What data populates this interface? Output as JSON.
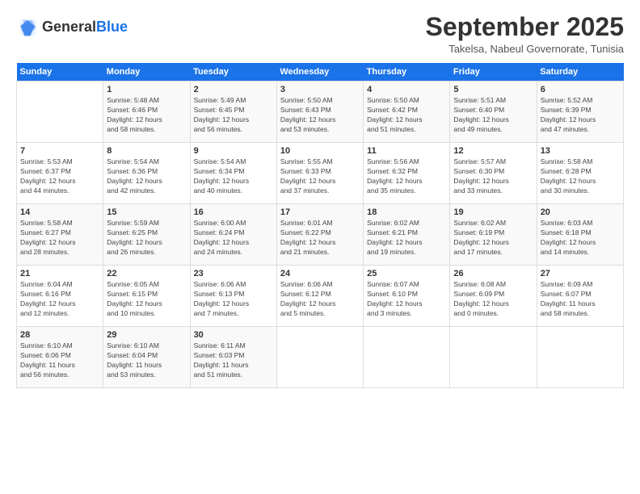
{
  "logo": {
    "line1": "General",
    "line2": "Blue"
  },
  "title": "September 2025",
  "subtitle": "Takelsa, Nabeul Governorate, Tunisia",
  "days_of_week": [
    "Sunday",
    "Monday",
    "Tuesday",
    "Wednesday",
    "Thursday",
    "Friday",
    "Saturday"
  ],
  "weeks": [
    [
      {
        "day": "",
        "info": ""
      },
      {
        "day": "1",
        "info": "Sunrise: 5:48 AM\nSunset: 6:46 PM\nDaylight: 12 hours\nand 58 minutes."
      },
      {
        "day": "2",
        "info": "Sunrise: 5:49 AM\nSunset: 6:45 PM\nDaylight: 12 hours\nand 56 minutes."
      },
      {
        "day": "3",
        "info": "Sunrise: 5:50 AM\nSunset: 6:43 PM\nDaylight: 12 hours\nand 53 minutes."
      },
      {
        "day": "4",
        "info": "Sunrise: 5:50 AM\nSunset: 6:42 PM\nDaylight: 12 hours\nand 51 minutes."
      },
      {
        "day": "5",
        "info": "Sunrise: 5:51 AM\nSunset: 6:40 PM\nDaylight: 12 hours\nand 49 minutes."
      },
      {
        "day": "6",
        "info": "Sunrise: 5:52 AM\nSunset: 6:39 PM\nDaylight: 12 hours\nand 47 minutes."
      }
    ],
    [
      {
        "day": "7",
        "info": "Sunrise: 5:53 AM\nSunset: 6:37 PM\nDaylight: 12 hours\nand 44 minutes."
      },
      {
        "day": "8",
        "info": "Sunrise: 5:54 AM\nSunset: 6:36 PM\nDaylight: 12 hours\nand 42 minutes."
      },
      {
        "day": "9",
        "info": "Sunrise: 5:54 AM\nSunset: 6:34 PM\nDaylight: 12 hours\nand 40 minutes."
      },
      {
        "day": "10",
        "info": "Sunrise: 5:55 AM\nSunset: 6:33 PM\nDaylight: 12 hours\nand 37 minutes."
      },
      {
        "day": "11",
        "info": "Sunrise: 5:56 AM\nSunset: 6:32 PM\nDaylight: 12 hours\nand 35 minutes."
      },
      {
        "day": "12",
        "info": "Sunrise: 5:57 AM\nSunset: 6:30 PM\nDaylight: 12 hours\nand 33 minutes."
      },
      {
        "day": "13",
        "info": "Sunrise: 5:58 AM\nSunset: 6:28 PM\nDaylight: 12 hours\nand 30 minutes."
      }
    ],
    [
      {
        "day": "14",
        "info": "Sunrise: 5:58 AM\nSunset: 6:27 PM\nDaylight: 12 hours\nand 28 minutes."
      },
      {
        "day": "15",
        "info": "Sunrise: 5:59 AM\nSunset: 6:25 PM\nDaylight: 12 hours\nand 26 minutes."
      },
      {
        "day": "16",
        "info": "Sunrise: 6:00 AM\nSunset: 6:24 PM\nDaylight: 12 hours\nand 24 minutes."
      },
      {
        "day": "17",
        "info": "Sunrise: 6:01 AM\nSunset: 6:22 PM\nDaylight: 12 hours\nand 21 minutes."
      },
      {
        "day": "18",
        "info": "Sunrise: 6:02 AM\nSunset: 6:21 PM\nDaylight: 12 hours\nand 19 minutes."
      },
      {
        "day": "19",
        "info": "Sunrise: 6:02 AM\nSunset: 6:19 PM\nDaylight: 12 hours\nand 17 minutes."
      },
      {
        "day": "20",
        "info": "Sunrise: 6:03 AM\nSunset: 6:18 PM\nDaylight: 12 hours\nand 14 minutes."
      }
    ],
    [
      {
        "day": "21",
        "info": "Sunrise: 6:04 AM\nSunset: 6:16 PM\nDaylight: 12 hours\nand 12 minutes."
      },
      {
        "day": "22",
        "info": "Sunrise: 6:05 AM\nSunset: 6:15 PM\nDaylight: 12 hours\nand 10 minutes."
      },
      {
        "day": "23",
        "info": "Sunrise: 6:06 AM\nSunset: 6:13 PM\nDaylight: 12 hours\nand 7 minutes."
      },
      {
        "day": "24",
        "info": "Sunrise: 6:06 AM\nSunset: 6:12 PM\nDaylight: 12 hours\nand 5 minutes."
      },
      {
        "day": "25",
        "info": "Sunrise: 6:07 AM\nSunset: 6:10 PM\nDaylight: 12 hours\nand 3 minutes."
      },
      {
        "day": "26",
        "info": "Sunrise: 6:08 AM\nSunset: 6:09 PM\nDaylight: 12 hours\nand 0 minutes."
      },
      {
        "day": "27",
        "info": "Sunrise: 6:09 AM\nSunset: 6:07 PM\nDaylight: 11 hours\nand 58 minutes."
      }
    ],
    [
      {
        "day": "28",
        "info": "Sunrise: 6:10 AM\nSunset: 6:06 PM\nDaylight: 11 hours\nand 56 minutes."
      },
      {
        "day": "29",
        "info": "Sunrise: 6:10 AM\nSunset: 6:04 PM\nDaylight: 11 hours\nand 53 minutes."
      },
      {
        "day": "30",
        "info": "Sunrise: 6:11 AM\nSunset: 6:03 PM\nDaylight: 11 hours\nand 51 minutes."
      },
      {
        "day": "",
        "info": ""
      },
      {
        "day": "",
        "info": ""
      },
      {
        "day": "",
        "info": ""
      },
      {
        "day": "",
        "info": ""
      }
    ]
  ]
}
